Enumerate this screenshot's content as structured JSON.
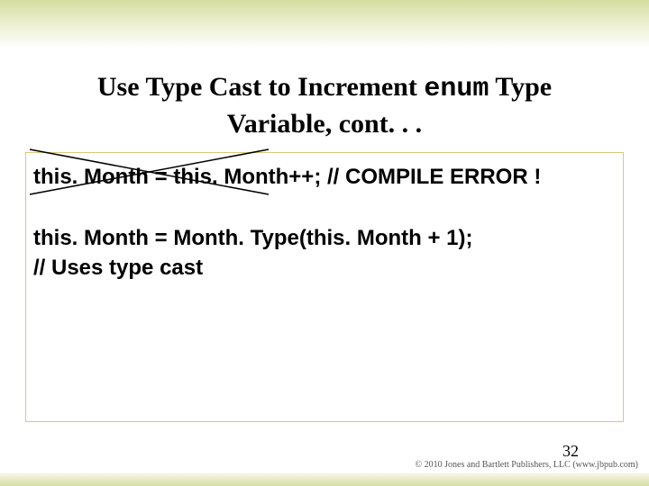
{
  "title": {
    "part1": "Use Type Cast to Increment ",
    "enum": "enum",
    "part2": " Type",
    "line2": "Variable, cont. . ."
  },
  "code": {
    "line1": "this. Month = this. Month++; // COMPILE ERROR !",
    "line2": "this. Month = Month. Type(this. Month + 1);",
    "line3": "// Uses type cast"
  },
  "page_number": "32",
  "copyright": "© 2010 Jones and Bartlett Publishers, LLC (www.jbpub.com)"
}
